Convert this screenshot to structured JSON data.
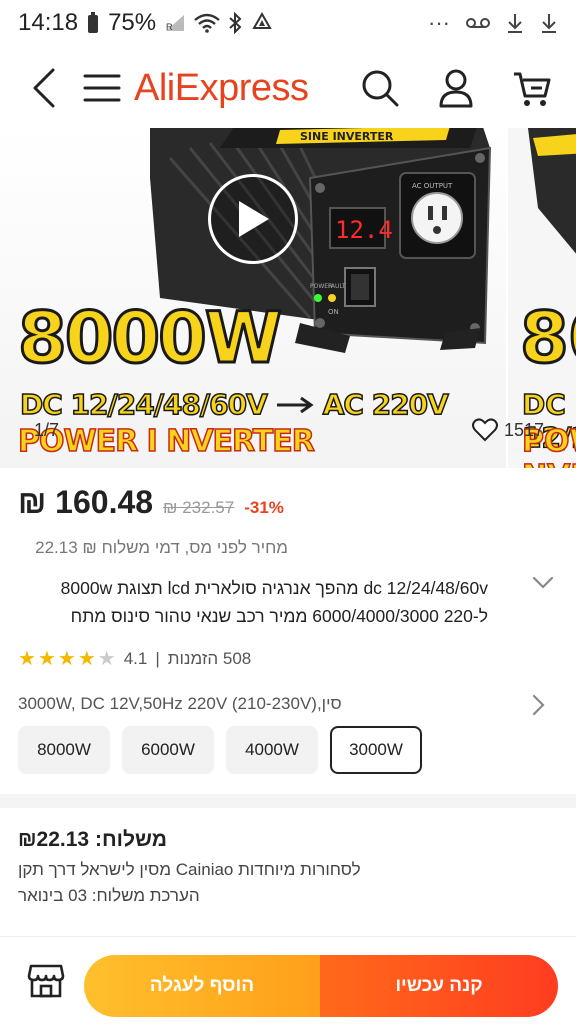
{
  "status_bar": {
    "time": "14:18",
    "battery": "75%",
    "dots": "···"
  },
  "header": {
    "logo": "AliExpress",
    "icons": [
      "back-icon",
      "menu-icon",
      "search-icon",
      "account-icon",
      "cart-icon"
    ]
  },
  "gallery": {
    "headline": "8000W",
    "conversion_from": "DC 12/24/48/60V",
    "conversion_to": "AC 220V",
    "banner": "POWER I NVERTER",
    "display_reading": "12.4",
    "panel_labels": {
      "output": "AC OUTPUT",
      "power": "POWER",
      "fault": "FAULT",
      "on": "ON",
      "top_label": "SINE INVERTER"
    },
    "counter": "1/7",
    "likes": "1517"
  },
  "price": {
    "current": "₪ 160.48",
    "original": "₪ 232.57",
    "discount": "-31%",
    "tax_note": "מחיר לפני מס, דמי משלוח ₪ 22.13"
  },
  "title": {
    "line1": "dc 12/24/48/60v מהפך אנרגיה סולארית lcd תצוגת 8000w",
    "line2": "ל-220 6000/4000/3000 ממיר רכב שנאי טהור סינוס מתח"
  },
  "rating": {
    "score": "4.1",
    "stars_filled": 4,
    "stars_total": 5,
    "orders": "508 הזמנות"
  },
  "variants": {
    "label": "3000W, DC 12V,50Hz 220V (210-230V),סין",
    "options": [
      "8000W",
      "6000W",
      "4000W",
      "3000W"
    ],
    "selected": "3000W"
  },
  "shipping": {
    "title": "משלוח: ₪22.13",
    "line1": "לסחורות מיוחדות Cainiao מסין לישראל דרך תקן",
    "line2": "הערכת משלוח: 03 בינואר"
  },
  "actions": {
    "add_to_cart": "הוסף לעגלה",
    "buy_now": "קנה עכשיו"
  },
  "colors": {
    "brand": "#e8431f",
    "cart_button": "#ffb020",
    "buy_button": "#ff4b1f",
    "discount": "#e8431f"
  }
}
